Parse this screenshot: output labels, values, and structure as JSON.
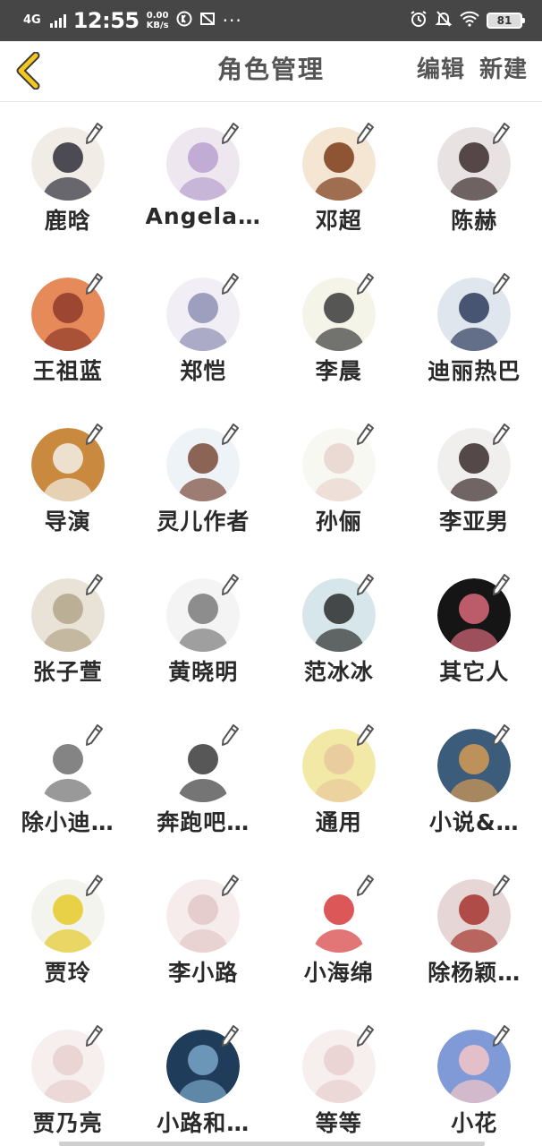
{
  "status_bar": {
    "network": "4G",
    "time": "12:55",
    "speed_value": "0.00",
    "speed_unit": "KB/s",
    "battery": "81"
  },
  "header": {
    "title": "角色管理",
    "edit_label": "编辑",
    "new_label": "新建"
  },
  "colors": {
    "accent": "#f4c81c",
    "text": "#2a2a2a",
    "title": "#555555",
    "status_bar": "#464646"
  },
  "characters": [
    {
      "name": "鹿晗",
      "bg": "#f1ece6",
      "fg": "#2f2f3a"
    },
    {
      "name": "Angela…",
      "bg": "#efe7ef",
      "fg": "#b7a1cf"
    },
    {
      "name": "邓超",
      "bg": "#f5e6d3",
      "fg": "#7a3b18"
    },
    {
      "name": "陈赫",
      "bg": "#e8e2e2",
      "fg": "#3b2c2c"
    },
    {
      "name": "王祖蓝",
      "bg": "#e78a5a",
      "fg": "#8f3a2a"
    },
    {
      "name": "郑恺",
      "bg": "#f1eff5",
      "fg": "#8f8fb4"
    },
    {
      "name": "李晨",
      "bg": "#f5f4e9",
      "fg": "#3a3a3a"
    },
    {
      "name": "迪丽热巴",
      "bg": "#dfe6ee",
      "fg": "#2e3b5c"
    },
    {
      "name": "导演",
      "bg": "#c98a3f",
      "fg": "#f3efe8"
    },
    {
      "name": "灵儿作者",
      "bg": "#eef3f8",
      "fg": "#7a4a3a"
    },
    {
      "name": "孙俪",
      "bg": "#f8f8f2",
      "fg": "#e9d4cf"
    },
    {
      "name": "李亚男",
      "bg": "#f1eeee",
      "fg": "#3a2a2a"
    },
    {
      "name": "张子萱",
      "bg": "#e9e2d6",
      "fg": "#b3a68a"
    },
    {
      "name": "黄晓明",
      "bg": "#f4f4f4",
      "fg": "#7a7a7a"
    },
    {
      "name": "范冰冰",
      "bg": "#d6e6ea",
      "fg": "#2c2c2c"
    },
    {
      "name": "其它人",
      "bg": "#151515",
      "fg": "#d9687a"
    },
    {
      "name": "除小迪…",
      "bg": "#ffffff",
      "fg": "#6e6e6e"
    },
    {
      "name": "奔跑吧…",
      "bg": "#ffffff",
      "fg": "#3a3a3a"
    },
    {
      "name": "通用",
      "bg": "#f2e9a6",
      "fg": "#e9c89c"
    },
    {
      "name": "小说&…",
      "bg": "#3b5c7a",
      "fg": "#d49a55"
    },
    {
      "name": "贾玲",
      "bg": "#f4f4ee",
      "fg": "#e5c929"
    },
    {
      "name": "李小路",
      "bg": "#f7ecec",
      "fg": "#e3c8c8"
    },
    {
      "name": "小海绵",
      "bg": "#ffffff",
      "fg": "#d63a3a"
    },
    {
      "name": "除杨颖…",
      "bg": "#e6d6d6",
      "fg": "#a4342e"
    },
    {
      "name": "贾乃亮",
      "bg": "#f7eeee",
      "fg": "#e8cfcf"
    },
    {
      "name": "小路和…",
      "bg": "#1f3c5a",
      "fg": "#7aa6c8"
    },
    {
      "name": "等等",
      "bg": "#f7eeee",
      "fg": "#e8cfcf"
    },
    {
      "name": "小花",
      "bg": "#7f9ad6",
      "fg": "#f5c7c7"
    }
  ]
}
